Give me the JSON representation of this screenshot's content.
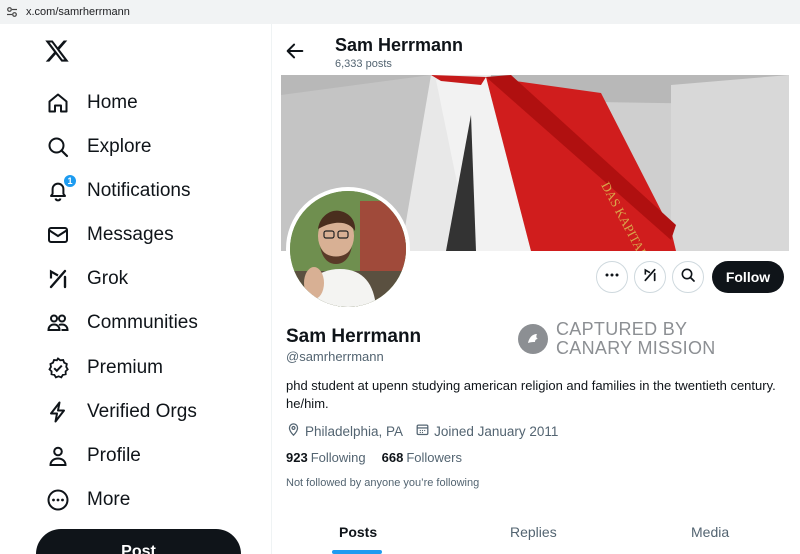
{
  "browser": {
    "url": "x.com/samrherrmann"
  },
  "sidebar": {
    "items": [
      {
        "label": "Home",
        "icon": "home-icon"
      },
      {
        "label": "Explore",
        "icon": "search-icon"
      },
      {
        "label": "Notifications",
        "icon": "bell-icon",
        "badge": "1"
      },
      {
        "label": "Messages",
        "icon": "mail-icon"
      },
      {
        "label": "Grok",
        "icon": "grok-icon"
      },
      {
        "label": "Communities",
        "icon": "communities-icon"
      },
      {
        "label": "Premium",
        "icon": "verified-icon"
      },
      {
        "label": "Verified Orgs",
        "icon": "lightning-icon"
      },
      {
        "label": "Profile",
        "icon": "person-icon"
      },
      {
        "label": "More",
        "icon": "more-circle-icon"
      }
    ],
    "post_label": "Post"
  },
  "header": {
    "name": "Sam Herrmann",
    "post_count": "6,333 posts"
  },
  "profile": {
    "name": "Sam Herrmann",
    "handle": "@samrherrmann",
    "bio": "phd student at upenn studying american religion and families in the twentieth century. he/him.",
    "location": "Philadelphia, PA",
    "joined": "Joined January 2011",
    "following_count": "923",
    "following_label": "Following",
    "followers_count": "668",
    "followers_label": "Followers",
    "not_followed": "Not followed by anyone you’re following",
    "follow_label": "Follow"
  },
  "banner": {
    "book_spine_text": "DAS KAPITAL"
  },
  "watermark": {
    "line1": "CAPTURED BY",
    "line2": "CANARY MISSION"
  },
  "tabs": [
    "Posts",
    "Replies",
    "Media"
  ],
  "colors": {
    "accent": "#1d9bf0",
    "text": "#0f1419",
    "muted": "#536471"
  }
}
